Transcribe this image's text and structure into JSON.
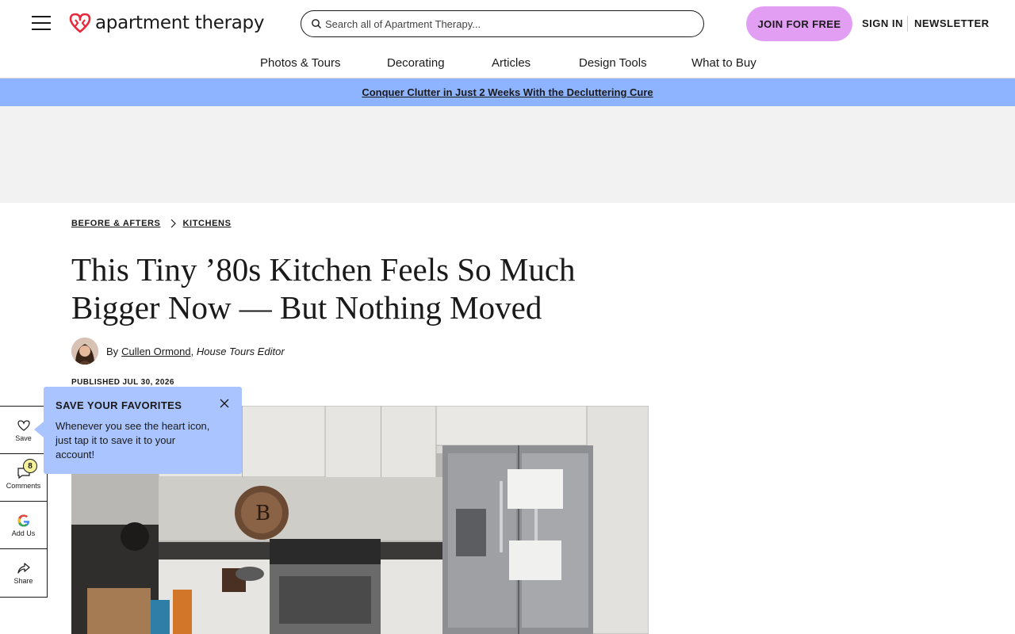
{
  "header": {
    "logo_text": "apartment therapy",
    "search_placeholder": "Search all of Apartment Therapy...",
    "join_label": "JOIN FOR FREE",
    "signin_label": "SIGN IN",
    "newsletter_label": "NEWSLETTER",
    "accent_color": "#e29ef3",
    "logo_color": "#e8293b"
  },
  "nav": {
    "items": [
      {
        "label": "Photos & Tours"
      },
      {
        "label": "Decorating"
      },
      {
        "label": "Articles"
      },
      {
        "label": "Design Tools"
      },
      {
        "label": "What to Buy"
      }
    ]
  },
  "promo": {
    "text": "Conquer Clutter in Just 2 Weeks With the Decluttering Cure",
    "color": "#8fb4ff"
  },
  "article": {
    "breadcrumbs": [
      "BEFORE & AFTERS",
      "KITCHENS"
    ],
    "title": "This Tiny ’80s Kitchen Feels So Much Bigger Now — But Nothing Moved",
    "by": "By",
    "author": "Cullen Ormond",
    "author_role": "House Tours Editor",
    "published": "PUBLISHED JUL 30, 2026"
  },
  "rail": {
    "save_label": "Save",
    "comments_label": "Comments",
    "comments_count": "8",
    "add_us_label": "Add Us",
    "share_label": "Share"
  },
  "tooltip": {
    "title": "SAVE YOUR FAVORITES",
    "body": "Whenever you see the heart icon, just tap it to save it to your account!",
    "color": "#a9c4ff"
  }
}
